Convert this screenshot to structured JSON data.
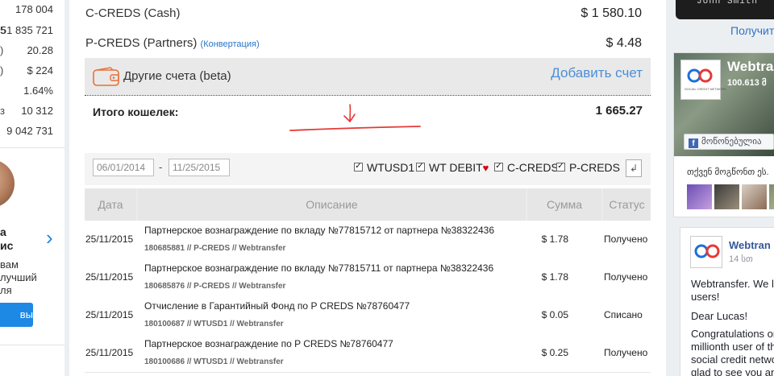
{
  "left_stats": [
    {
      "label": "",
      "value": "178 004"
    },
    {
      "label": "5",
      "value": "51 835 721"
    },
    {
      "label": ")",
      "value": "20.28"
    },
    {
      "label": ")",
      "value": "$ 224"
    },
    {
      "label": "",
      "value": "1.64%"
    },
    {
      "label": "з",
      "value": "10 312"
    },
    {
      "label": "",
      "value": "9 042 731"
    }
  ],
  "promo": {
    "name_line1": "а",
    "name_line2": "ис",
    "text_lines": [
      "вам",
      "лучший",
      "ля"
    ],
    "button_label": "вы"
  },
  "accounts": [
    {
      "name": "C-CREDS (Cash)",
      "amount": "$ 1 580.10"
    },
    {
      "name": "P-CREDS (Partners)",
      "conversion_link": "(Конвертация)",
      "amount": "$ 4.48"
    }
  ],
  "other_accounts": {
    "label": "Другие счета (beta)",
    "add_label": "Добавить счет"
  },
  "total": {
    "label": "Итого кошелек:",
    "amount": "1 665.27"
  },
  "filter": {
    "date_from": "06/01/2014",
    "separator": "-",
    "date_to": "11/25/2015",
    "checkboxes": [
      {
        "label": "WTUSD1",
        "checked": true
      },
      {
        "label": "WT DEBIT",
        "checked": true
      },
      {
        "label": "C-CREDS",
        "checked": true
      },
      {
        "label": "P-CREDS",
        "checked": true
      }
    ]
  },
  "table": {
    "headers": [
      "Дата",
      "Описание",
      "Сумма",
      "Статус"
    ],
    "rows": [
      {
        "date": "25/11/2015",
        "description": "Партнерское вознаграждение по вкладу №77815712 от партнера №38322436",
        "sub": "180685881 // P-CREDS // Webtransfer",
        "sum": "$ 1.78",
        "status": "Получено"
      },
      {
        "date": "25/11/2015",
        "description": "Партнерское вознаграждение по вкладу №77815711 от партнера №38322436",
        "sub": "180685876 // P-CREDS // Webtransfer",
        "sum": "$ 1.78",
        "status": "Получено"
      },
      {
        "date": "25/11/2015",
        "description": "Отчисление в Гарантийный Фонд по P CREDS №78760477",
        "sub": "180100687 // WTUSD1 // Webtransfer",
        "sum": "$ 0.05",
        "status": "Списано"
      },
      {
        "date": "25/11/2015",
        "description": "Партнерское вознаграждение по P CREDS №78760477",
        "sub": "180100686 // WTUSD1 // Webtransfer",
        "sum": "$ 0.25",
        "status": "Получено"
      }
    ]
  },
  "right": {
    "card_holder": "John Smith",
    "get_link": "Получит",
    "fb_page": {
      "title": "Webtrans",
      "likes": "100.613 მ",
      "like_button": "მოწონებულია",
      "logo_text": "SOCIAL CREDIT NETWORK",
      "friends_text": "თქვენ მოგწონთ ეს."
    },
    "post": {
      "title": "Webtran",
      "time": "14 სთ",
      "lines": [
        "Webtransfer. We l",
        "users!",
        "",
        "Dear Lucas!",
        "",
        "Congratulations on",
        "millionth user of th",
        "social credit netwo",
        "glad to see you an"
      ]
    }
  },
  "colors": {
    "accent": "#1e88e5",
    "link": "#2b74c7",
    "heart": "#d0021b",
    "annotation": "#e53935"
  }
}
